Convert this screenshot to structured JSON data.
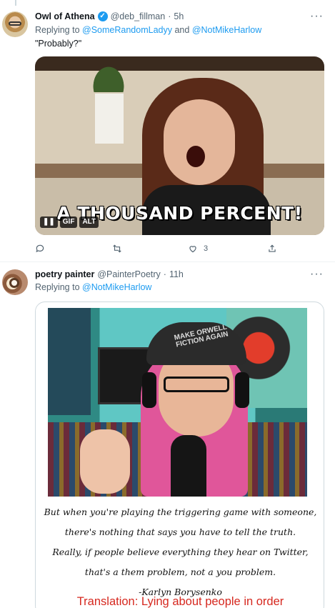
{
  "tweet1": {
    "name": "Owl of Athena",
    "handle": "@deb_fillman",
    "separator": "·",
    "time": "5h",
    "replying_prefix": "Replying to",
    "replying_user1": "@SomeRandomLadyy",
    "replying_and": "and",
    "replying_user2": "@NotMikeHarlow",
    "text": "\"Probably?\"",
    "gif": {
      "caption": "A THOUSAND PERCENT!",
      "badge_gif": "GIF",
      "badge_alt": "ALT"
    },
    "actions": {
      "reply_count": "",
      "retweet_count": "",
      "like_count": "3"
    }
  },
  "tweet2": {
    "name": "poetry painter",
    "handle": "@PainterPoetry",
    "separator": "·",
    "time": "11h",
    "replying_prefix": "Replying to",
    "replying_user": "@NotMikeHarlow",
    "image": {
      "cap_text": "MAKE ORWELL FICTION AGAIN",
      "quote_lines": [
        "But when you're playing the triggering game with someone,",
        "there's nothing that says you have to tell the truth.",
        "Really, if people believe everything they hear on Twitter,",
        "that's a them problem, not a you problem.",
        "-Karlyn Borysenko"
      ],
      "translation": "Translation: Lying about people in order"
    }
  },
  "icons": {
    "verified": "verified-badge-icon",
    "more": "more-options-icon",
    "reply": "reply-icon",
    "retweet": "retweet-icon",
    "like": "heart-icon",
    "share": "share-icon"
  },
  "colors": {
    "link": "#1d9bf0",
    "secondary_text": "#536471",
    "translation_red": "#d6281f"
  }
}
